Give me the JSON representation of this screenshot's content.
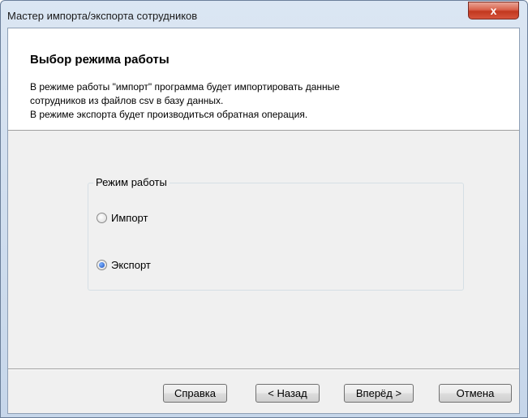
{
  "window": {
    "title": "Мастер импорта/экспорта сотрудников",
    "close_label": "x"
  },
  "header": {
    "title": "Выбор режима работы",
    "description_lines": [
      "В режиме работы \"импорт\" программа будет импортировать данные",
      "сотрудников из файлов csv в базу данных.",
      "В режиме экспорта будет производиться обратная операция."
    ]
  },
  "mode_group": {
    "label": "Режим работы",
    "options": [
      {
        "label": "Импорт",
        "checked": false
      },
      {
        "label": "Экспорт",
        "checked": true
      }
    ]
  },
  "buttons": {
    "help": "Справка",
    "back": "< Назад",
    "next": "Вперёд >",
    "cancel": "Отмена"
  }
}
